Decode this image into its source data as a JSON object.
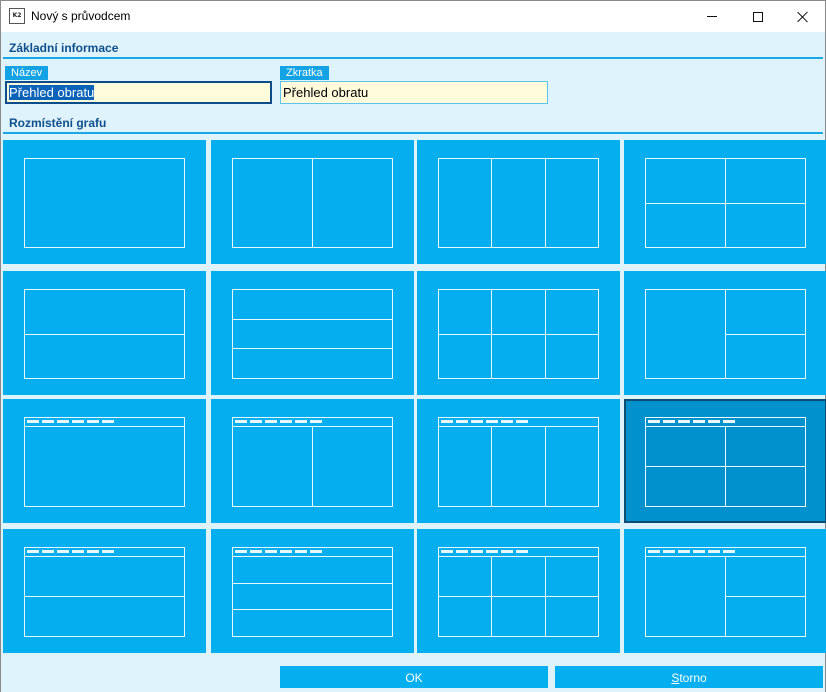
{
  "window": {
    "title": "Nový s průvodcem",
    "icon_text": "K2"
  },
  "sections": {
    "basic_info": "Základní informace",
    "chart_layout": "Rozmístění grafu"
  },
  "fields": {
    "name": {
      "label": "Název",
      "value": "Přehled obratu"
    },
    "abbreviation": {
      "label": "Zkratka",
      "value": "Přehled obratu"
    }
  },
  "layouts": [
    {
      "name": "single",
      "toolbar": false
    },
    {
      "name": "two-columns",
      "toolbar": false
    },
    {
      "name": "three-columns",
      "toolbar": false
    },
    {
      "name": "four-quadrants",
      "toolbar": false
    },
    {
      "name": "two-rows",
      "toolbar": false
    },
    {
      "name": "three-rows",
      "toolbar": false
    },
    {
      "name": "six-cells",
      "toolbar": false
    },
    {
      "name": "left-plus-two-right",
      "toolbar": false
    },
    {
      "name": "toolbar-single",
      "toolbar": true
    },
    {
      "name": "toolbar-two-columns",
      "toolbar": true
    },
    {
      "name": "toolbar-three-columns",
      "toolbar": true
    },
    {
      "name": "toolbar-four-quadrants",
      "toolbar": true,
      "selected": true
    },
    {
      "name": "toolbar-two-rows",
      "toolbar": true
    },
    {
      "name": "toolbar-three-rows",
      "toolbar": true
    },
    {
      "name": "toolbar-six-cells",
      "toolbar": true
    },
    {
      "name": "toolbar-left-plus-two-right",
      "toolbar": true
    }
  ],
  "buttons": {
    "ok": "OK",
    "cancel": "Storno"
  },
  "colors": {
    "accent": "#04aeef",
    "selected_tile": "#0192cd",
    "header_text": "#0e4f8c",
    "input_bg": "#fffbdb"
  }
}
